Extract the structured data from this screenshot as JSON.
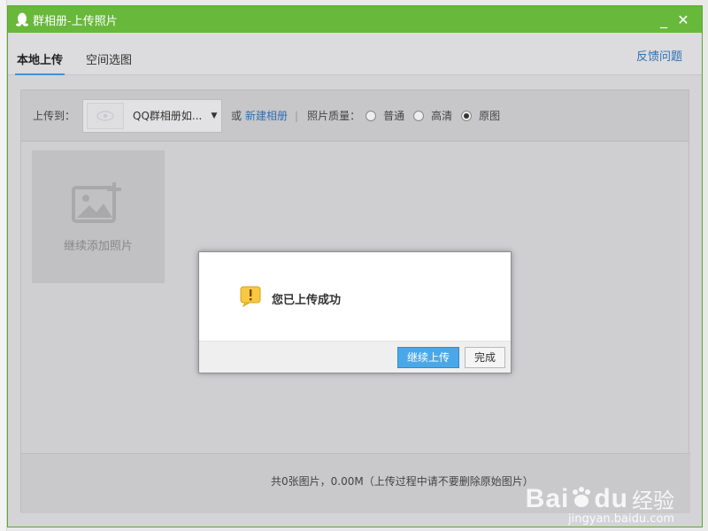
{
  "window": {
    "title": "群相册-上传照片",
    "minimize_glyph": "_",
    "close_glyph": "✕"
  },
  "tabs": [
    {
      "label": "本地上传",
      "active": true
    },
    {
      "label": "空间选图",
      "active": false
    }
  ],
  "feedback_label": "反馈问题",
  "toolbar": {
    "upload_to_label": "上传到：",
    "album_name": "QQ群相册如...",
    "or_label": "或",
    "new_album_label": "新建相册",
    "separator": "|",
    "quality_label": "照片质量：",
    "quality_options": [
      {
        "label": "普通",
        "checked": false
      },
      {
        "label": "高清",
        "checked": false
      },
      {
        "label": "原图",
        "checked": true
      }
    ]
  },
  "add_tile": {
    "label": "继续添加照片",
    "icon": "add-photo-icon"
  },
  "footer": {
    "summary": "共0张图片，0.00M（上传过程中请不要删除原始图片）"
  },
  "modal": {
    "message": "您已上传成功",
    "icon": "warning-icon",
    "continue_label": "继续上传",
    "done_label": "完成"
  },
  "watermark": {
    "brand": "Bai",
    "suffix": "du",
    "jingyan": "经验",
    "url": "jingyan.baidu.com"
  },
  "colors": {
    "titlebar": "#68b83b",
    "link": "#2f6fb4",
    "primary_button": "#4aa8e8"
  }
}
